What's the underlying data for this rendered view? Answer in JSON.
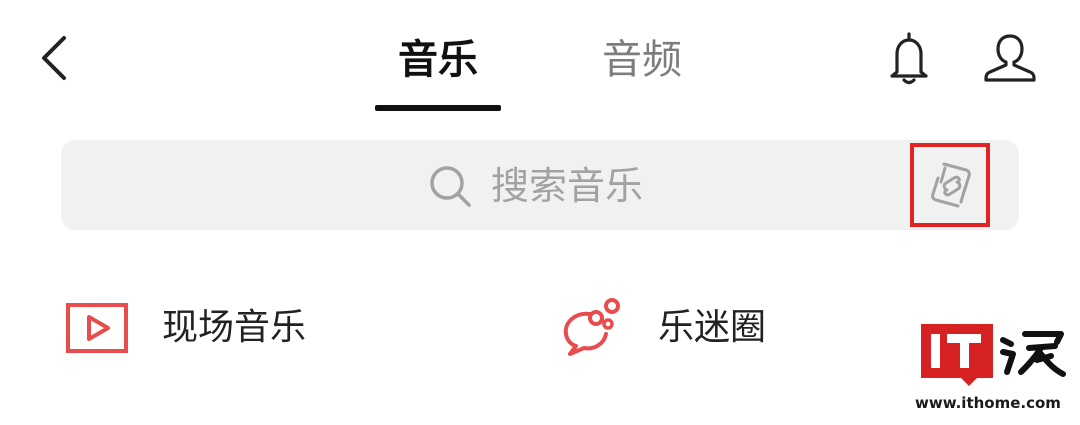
{
  "header": {
    "back_icon": "chevron-left-icon",
    "tabs": [
      {
        "label": "音乐",
        "active": true
      },
      {
        "label": "音频",
        "active": false
      }
    ],
    "notification_icon": "bell-icon",
    "profile_icon": "user-icon"
  },
  "search": {
    "placeholder": "搜索音乐",
    "search_icon": "search-icon",
    "recognize_icon": "music-recognition-icon",
    "highlight_color": "#e02424"
  },
  "shortcuts": [
    {
      "label": "现场音乐",
      "icon": "live-video-icon"
    },
    {
      "label": "乐迷圈",
      "icon": "chat-bubble-icon"
    }
  ],
  "colors": {
    "accent": "#e84c4c",
    "tab_active": "#111111",
    "tab_inactive": "#7d7d7d",
    "search_bg": "#f1f1f1"
  },
  "watermark": {
    "logo_text": "IT之家",
    "url": "www.ithome.com"
  }
}
